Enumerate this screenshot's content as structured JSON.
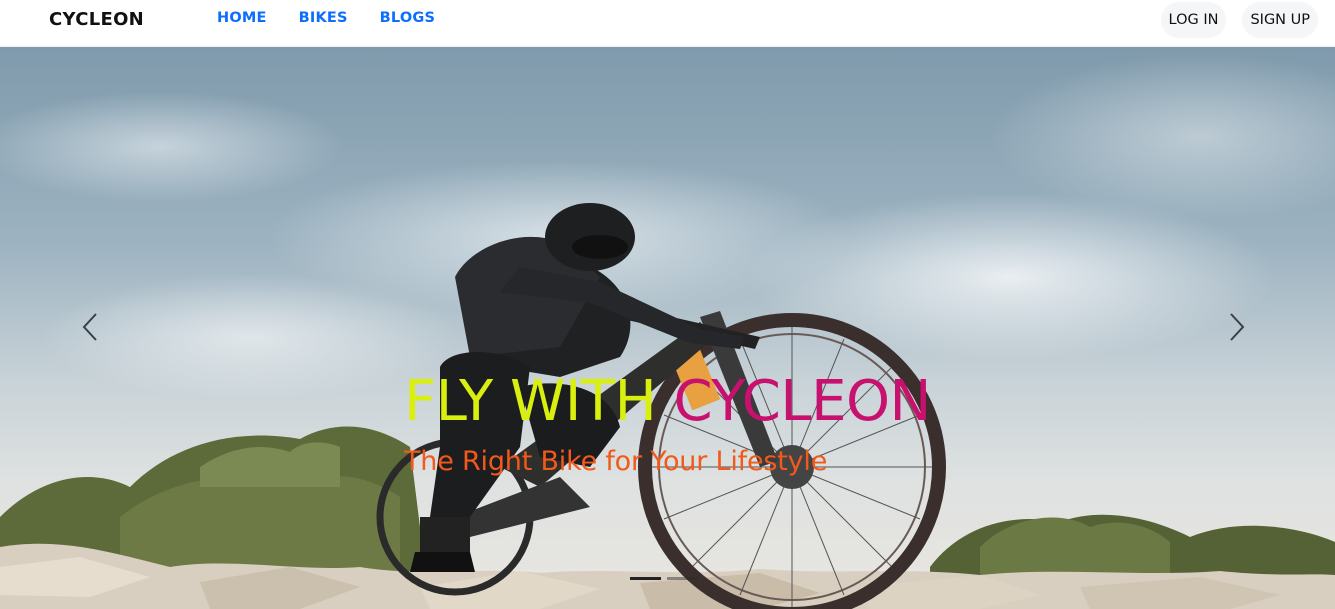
{
  "navbar": {
    "brand": "CYCLEON",
    "links": [
      {
        "label": "HOME"
      },
      {
        "label": "BIKES"
      },
      {
        "label": "BLOGS"
      }
    ],
    "auth": {
      "login_label": "LOG IN",
      "signup_label": "SIGN UP"
    },
    "link_color": "#0d6efd"
  },
  "hero": {
    "headline_part1": "FLY WITH",
    "headline_part2": "CYCLEON",
    "tagline": "The Right Bike for Your Lifestyle",
    "prev_icon": "chevron-left-icon",
    "next_icon": "chevron-right-icon",
    "indicators": {
      "count": 2,
      "active": 1
    },
    "colors": {
      "headline_part1": "#d9ef0e",
      "headline_part2": "#c8106e",
      "tagline": "#f2591a"
    }
  }
}
